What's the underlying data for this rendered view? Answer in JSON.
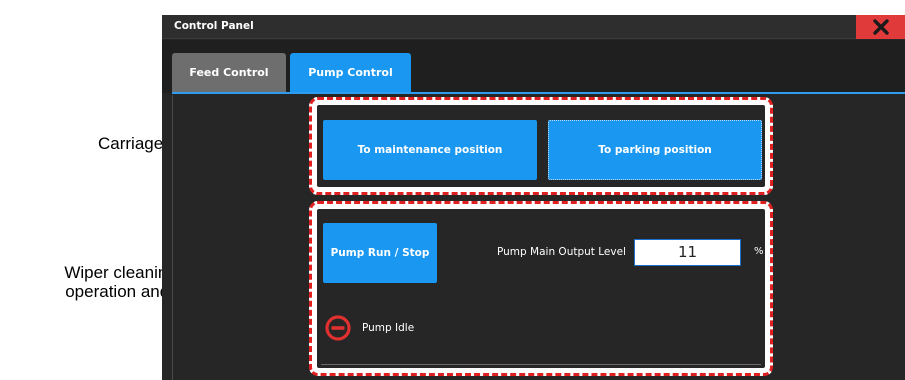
{
  "annotations": {
    "carriage": "Carriage operation",
    "wiper": "Wiper cleaning pump output\noperation and output setting"
  },
  "window": {
    "title": "Control Panel",
    "close_icon": "close-x-icon"
  },
  "tabs": [
    {
      "label": "Feed Control",
      "active": false
    },
    {
      "label": "Pump Control",
      "active": true
    }
  ],
  "carriage": {
    "maintenance_label": "To maintenance position",
    "parking_label": "To parking position"
  },
  "pump": {
    "run_stop_label": "Pump Run / Stop",
    "output_level_label": "Pump Main Output Level",
    "output_level_value": "11",
    "output_unit": "%",
    "status_icon": "stop-circle-icon",
    "status_text": "Pump Idle"
  },
  "colors": {
    "accent": "#1a97f0",
    "close": "#e03a3a",
    "annotation_dash": "#e02020",
    "status_icon": "#e03030",
    "background": "#262626"
  }
}
